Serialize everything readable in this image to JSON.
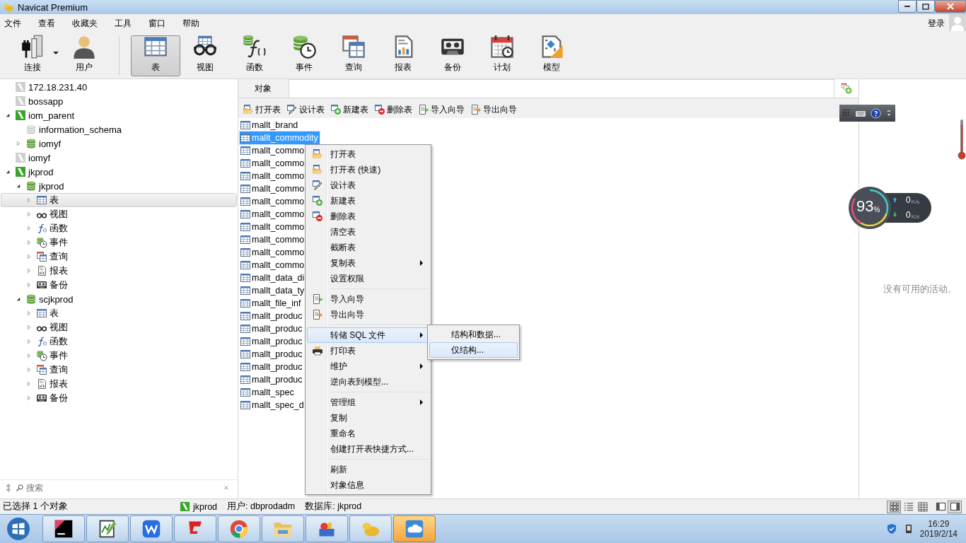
{
  "window": {
    "title": "Navicat Premium"
  },
  "menu_bar": {
    "items": [
      "文件",
      "查看",
      "收藏夹",
      "工具",
      "窗口",
      "帮助"
    ],
    "login": "登录"
  },
  "toolbar": [
    {
      "kind": "connection",
      "label": "连接",
      "selected": false,
      "dropdown": true
    },
    {
      "kind": "user",
      "label": "用户",
      "selected": false
    },
    {
      "kind": "table",
      "label": "表",
      "selected": true
    },
    {
      "kind": "view",
      "label": "视图",
      "selected": false
    },
    {
      "kind": "function",
      "label": "函数",
      "selected": false
    },
    {
      "kind": "event",
      "label": "事件",
      "selected": false
    },
    {
      "kind": "query",
      "label": "查询",
      "selected": false
    },
    {
      "kind": "report",
      "label": "报表",
      "selected": false
    },
    {
      "kind": "backup",
      "label": "备份",
      "selected": false
    },
    {
      "kind": "schedule",
      "label": "计划",
      "selected": false
    },
    {
      "kind": "model",
      "label": "模型",
      "selected": false
    }
  ],
  "navigator": {
    "tree": [
      {
        "label": "172.18.231.40",
        "kind": "connection",
        "connected": false,
        "selected": false
      },
      {
        "label": "bossapp",
        "kind": "connection",
        "connected": false,
        "selected": false
      },
      {
        "label": "iom_parent",
        "kind": "connection",
        "connected": true,
        "expanded": true,
        "selected": false,
        "children": [
          {
            "label": "information_schema",
            "kind": "database",
            "connected": false,
            "selected": false
          },
          {
            "label": "iomyf",
            "kind": "database",
            "connected": true,
            "expanded": false,
            "selected": false
          }
        ]
      },
      {
        "label": "iomyf",
        "kind": "connection",
        "connected": false,
        "selected": false
      },
      {
        "label": "jkprod",
        "kind": "connection",
        "connected": true,
        "expanded": true,
        "selected": false,
        "children": [
          {
            "label": "jkprod",
            "kind": "database",
            "connected": true,
            "expanded": true,
            "selected": false,
            "children": [
              {
                "label": "表",
                "kind": "table",
                "expanded": false,
                "selected": true
              },
              {
                "label": "视图",
                "kind": "view",
                "expanded": false,
                "selected": false
              },
              {
                "label": "函数",
                "kind": "function",
                "expanded": false,
                "selected": false
              },
              {
                "label": "事件",
                "kind": "event",
                "expanded": false,
                "selected": false
              },
              {
                "label": "查询",
                "kind": "query",
                "expanded": false,
                "selected": false
              },
              {
                "label": "报表",
                "kind": "report",
                "expanded": false,
                "selected": false
              },
              {
                "label": "备份",
                "kind": "backup",
                "expanded": false,
                "selected": false
              }
            ]
          },
          {
            "label": "scjkprod",
            "kind": "database",
            "connected": true,
            "expanded": true,
            "selected": false,
            "children": [
              {
                "label": "表",
                "kind": "table",
                "expanded": false,
                "selected": false
              },
              {
                "label": "视图",
                "kind": "view",
                "expanded": false,
                "selected": false
              },
              {
                "label": "函数",
                "kind": "function",
                "expanded": false,
                "selected": false
              },
              {
                "label": "事件",
                "kind": "event",
                "expanded": false,
                "selected": false
              },
              {
                "label": "查询",
                "kind": "query",
                "expanded": false,
                "selected": false
              },
              {
                "label": "报表",
                "kind": "report",
                "expanded": false,
                "selected": false
              },
              {
                "label": "备份",
                "kind": "backup",
                "expanded": false,
                "selected": false
              }
            ]
          }
        ]
      }
    ],
    "search": {
      "placeholder": "搜索"
    }
  },
  "objects": {
    "tabs": [
      {
        "label": "对象",
        "selected": true
      }
    ],
    "actions": [
      {
        "kind": "open",
        "label": "打开表"
      },
      {
        "kind": "design",
        "label": "设计表"
      },
      {
        "kind": "new",
        "label": "新建表"
      },
      {
        "kind": "delete",
        "label": "删除表"
      },
      {
        "kind": "import",
        "label": "导入向导"
      },
      {
        "kind": "export",
        "label": "导出向导"
      }
    ],
    "tables": [
      {
        "name": "mallt_brand",
        "selected": false
      },
      {
        "name": "mallt_commodity",
        "selected": true
      },
      {
        "name": "mallt_commo",
        "selected": false
      },
      {
        "name": "mallt_commo",
        "selected": false
      },
      {
        "name": "mallt_commo",
        "selected": false
      },
      {
        "name": "mallt_commo",
        "selected": false
      },
      {
        "name": "mallt_commo",
        "selected": false
      },
      {
        "name": "mallt_commo",
        "selected": false
      },
      {
        "name": "mallt_commo",
        "selected": false
      },
      {
        "name": "mallt_commo",
        "selected": false
      },
      {
        "name": "mallt_commo",
        "selected": false
      },
      {
        "name": "mallt_commo",
        "selected": false
      },
      {
        "name": "mallt_data_di",
        "selected": false
      },
      {
        "name": "mallt_data_ty",
        "selected": false
      },
      {
        "name": "mallt_file_inf",
        "selected": false
      },
      {
        "name": "mallt_produc",
        "selected": false
      },
      {
        "name": "mallt_produc",
        "selected": false
      },
      {
        "name": "mallt_produc",
        "selected": false
      },
      {
        "name": "mallt_produc",
        "selected": false
      },
      {
        "name": "mallt_produc",
        "selected": false
      },
      {
        "name": "mallt_produc",
        "selected": false
      },
      {
        "name": "mallt_spec",
        "selected": false
      },
      {
        "name": "mallt_spec_d",
        "selected": false
      }
    ]
  },
  "context_menu": {
    "items": [
      {
        "kind": "open",
        "label": "打开表",
        "submenu": false,
        "selected": false
      },
      {
        "kind": "open",
        "label": "打开表 (快速)",
        "submenu": false,
        "selected": false
      },
      {
        "kind": "design",
        "label": "设计表",
        "submenu": false,
        "selected": false
      },
      {
        "kind": "new",
        "label": "新建表",
        "submenu": false,
        "selected": false
      },
      {
        "kind": "delete",
        "label": "删除表",
        "submenu": false,
        "selected": false
      },
      {
        "kind": "plain",
        "label": "清空表",
        "submenu": false,
        "selected": false
      },
      {
        "kind": "plain",
        "label": "截断表",
        "submenu": false,
        "selected": false
      },
      {
        "kind": "plain",
        "label": "复制表",
        "submenu": true,
        "selected": false
      },
      {
        "kind": "plain",
        "label": "设置权限",
        "submenu": false,
        "selected": false
      },
      {
        "kind": "separator"
      },
      {
        "kind": "import",
        "label": "导入向导",
        "submenu": false,
        "selected": false
      },
      {
        "kind": "export",
        "label": "导出向导",
        "submenu": false,
        "selected": false
      },
      {
        "kind": "separator"
      },
      {
        "kind": "plain",
        "label": "转储 SQL 文件",
        "submenu": true,
        "selected": true
      },
      {
        "kind": "print",
        "label": "打印表",
        "submenu": false,
        "selected": false
      },
      {
        "kind": "plain",
        "label": "维护",
        "submenu": true,
        "selected": false
      },
      {
        "kind": "plain",
        "label": "逆向表到模型...",
        "submenu": false,
        "selected": false
      },
      {
        "kind": "separator"
      },
      {
        "kind": "plain",
        "label": "管理组",
        "submenu": true,
        "selected": false
      },
      {
        "kind": "plain",
        "label": "复制",
        "submenu": false,
        "selected": false
      },
      {
        "kind": "plain",
        "label": "重命名",
        "submenu": false,
        "selected": false
      },
      {
        "kind": "plain",
        "label": "创建打开表快捷方式...",
        "submenu": false,
        "selected": false
      },
      {
        "kind": "separator"
      },
      {
        "kind": "plain",
        "label": "刷新",
        "submenu": false,
        "selected": false
      },
      {
        "kind": "plain",
        "label": "对象信息",
        "submenu": false,
        "selected": false
      }
    ]
  },
  "submenu": {
    "items": [
      {
        "label": "结构和数据...",
        "selected": false
      },
      {
        "label": "仅结构...",
        "selected": true
      }
    ]
  },
  "right_panel": {
    "message": "没有可用的活动。"
  },
  "network_meter": {
    "percent": "93",
    "percent_unit": "%",
    "upload": "0",
    "upload_unit": "K/s",
    "download": "0",
    "download_unit": "K/s"
  },
  "status_bar": {
    "selection": "已选择 1 个对象",
    "connection": "jkprod",
    "user": "用户: dbprodadm",
    "database": "数据库: jkprod",
    "view_modes": [
      {
        "kind": "icons",
        "selected": true
      },
      {
        "kind": "list",
        "selected": false
      },
      {
        "kind": "details",
        "selected": false
      }
    ],
    "panels": [
      {
        "kind": "left",
        "selected": false
      },
      {
        "kind": "right",
        "selected": true
      }
    ]
  },
  "taskbar": {
    "apps": [
      {
        "kind": "ide",
        "selected": false
      },
      {
        "kind": "notepad",
        "selected": false
      },
      {
        "kind": "office",
        "selected": false
      },
      {
        "kind": "redapp",
        "selected": false
      },
      {
        "kind": "browser",
        "selected": false
      },
      {
        "kind": "explorer",
        "selected": false
      },
      {
        "kind": "toolbox",
        "selected": false
      },
      {
        "kind": "navicat",
        "selected": false
      },
      {
        "kind": "cloud",
        "selected": true
      }
    ],
    "clock": {
      "time": "16:29",
      "date": "2019/2/14"
    }
  }
}
